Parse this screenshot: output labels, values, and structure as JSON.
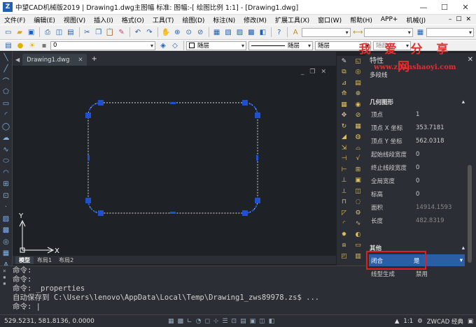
{
  "window": {
    "title": "中望CAD机械版2019 | Drawing1.dwg主图幅  标准: 图幅:-[ 绘图比例 1:1] - [Drawing1.dwg]",
    "logo": "Z",
    "minimize": "—",
    "maximize": "☐",
    "close": "✕"
  },
  "menu": {
    "items": [
      "文件(F)",
      "编辑(E)",
      "视图(V)",
      "插入(I)",
      "格式(O)",
      "工具(T)",
      "绘图(D)",
      "标注(N)",
      "修改(M)",
      "扩展工具(X)",
      "窗口(W)",
      "帮助(H)",
      "APP+",
      "机械(J)"
    ],
    "right_controls": [
      "–",
      "☐",
      "✕"
    ]
  },
  "toolbar2": {
    "layer_value": "0",
    "color_value": "随层",
    "linetype_value": "随层",
    "lineweight_value": "随层",
    "plotstyle_value": "随颜色"
  },
  "doc_tab": {
    "label": "Drawing1.dwg",
    "close": "✕",
    "plus": "+"
  },
  "canvas": {
    "ucs_x": "X",
    "ucs_y": "Y",
    "viewport_controls": [
      "_",
      "❐",
      "✕"
    ]
  },
  "layout_tabs": [
    "模型",
    "布局1",
    "布局2"
  ],
  "watermark": {
    "text": "我 爱 分 享 网",
    "url": "www.zhanshaoyi.com"
  },
  "properties": {
    "title": "特性",
    "close": "✕",
    "selection": "多段线",
    "geometry_section": "几何图形",
    "geometry_rows": [
      {
        "key": "顶点",
        "value": "1"
      },
      {
        "key": "顶点 X 坐标",
        "value": "353.7181"
      },
      {
        "key": "顶点 Y 坐标",
        "value": "562.0318"
      },
      {
        "key": "起始线段宽度",
        "value": "0"
      },
      {
        "key": "终止线段宽度",
        "value": "0"
      },
      {
        "key": "全局宽度",
        "value": "0"
      },
      {
        "key": "标高",
        "value": "0"
      },
      {
        "key": "面积",
        "value": "14914.1593"
      },
      {
        "key": "长度",
        "value": "482.8319"
      }
    ],
    "other_section": "其他",
    "closed_key": "闭合",
    "closed_value": "是",
    "linetype_gen_key": "线型生成",
    "linetype_gen_value": "禁用"
  },
  "command": {
    "lines": [
      "命令:",
      "命令:",
      "命令: _properties",
      "自动保存到 C:\\Users\\lenovo\\AppData\\Local\\Temp\\Drawing1_zws89978.zs$ ...",
      "命令: |"
    ]
  },
  "status": {
    "coords": "529.5231, 581.8136, 0.0000",
    "scale": "1:1",
    "brand": "ZWCAD 经典"
  },
  "colors": {
    "accent": "#1f5fb4",
    "highlight_row": "#2a5fa5",
    "callout": "#e02020",
    "watermark": "#e03030",
    "grip": "#2050d0"
  }
}
